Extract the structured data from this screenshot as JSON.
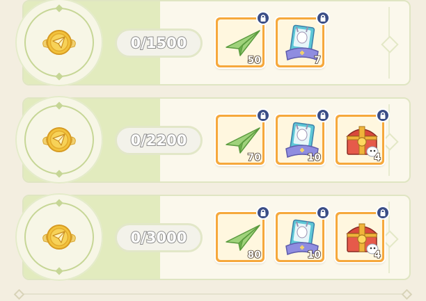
{
  "tiers": [
    {
      "progress": "0/1500",
      "rewards": [
        {
          "icon": "paper-plane-icon",
          "count": "50",
          "locked": true
        },
        {
          "icon": "card-pack-icon",
          "count": "7",
          "locked": true
        }
      ]
    },
    {
      "progress": "0/2200",
      "rewards": [
        {
          "icon": "paper-plane-icon",
          "count": "70",
          "locked": true
        },
        {
          "icon": "card-pack-icon",
          "count": "10",
          "locked": true
        },
        {
          "icon": "treasure-chest-icon",
          "count": "4",
          "locked": true
        }
      ]
    },
    {
      "progress": "0/3000",
      "rewards": [
        {
          "icon": "paper-plane-icon",
          "count": "80",
          "locked": true
        },
        {
          "icon": "card-pack-icon",
          "count": "10",
          "locked": true
        },
        {
          "icon": "treasure-chest-icon",
          "count": "4",
          "locked": true
        }
      ]
    }
  ],
  "colors": {
    "panel_bg": "#fbf8ec",
    "panel_accent": "#e2ebbe",
    "card_border": "#f6a83c",
    "lock_badge": "#3a4d86",
    "coin_gold": "#f2c23c"
  }
}
